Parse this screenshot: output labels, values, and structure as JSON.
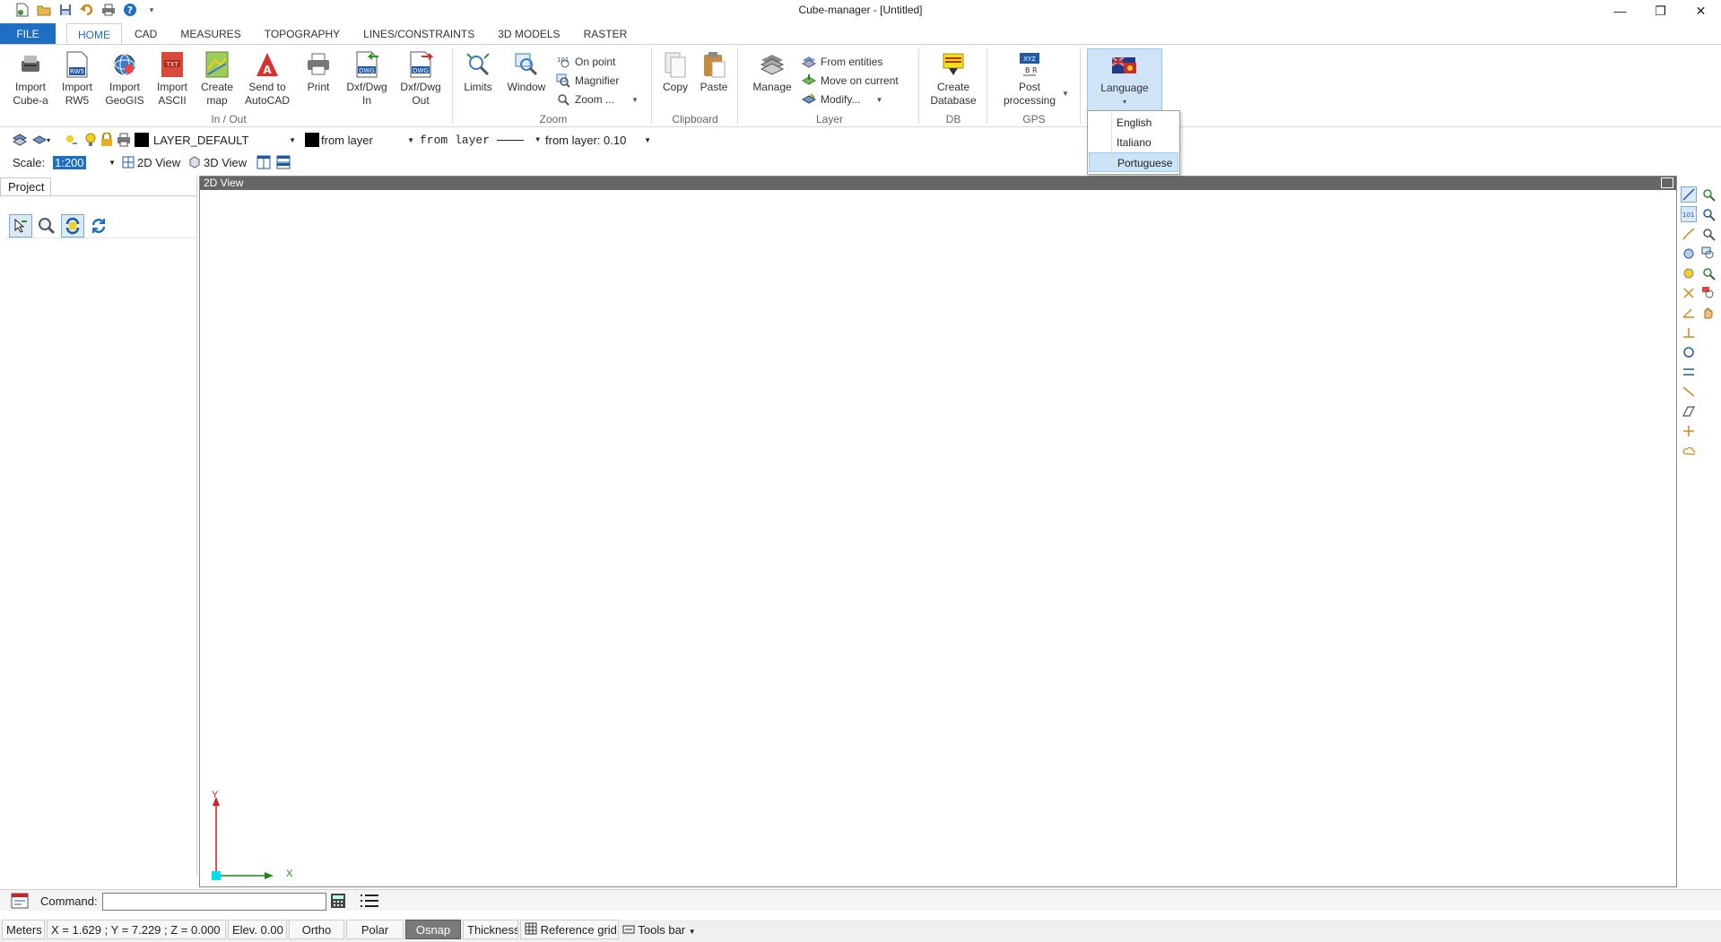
{
  "window": {
    "title": "Cube-manager - [Untitled]",
    "controls": [
      "—",
      "❐",
      "✕"
    ]
  },
  "tabs": [
    {
      "label": "FILE"
    },
    {
      "label": "HOME"
    },
    {
      "label": "CAD"
    },
    {
      "label": "MEASURES"
    },
    {
      "label": "TOPOGRAPHY"
    },
    {
      "label": "LINES/CONSTRAINTS"
    },
    {
      "label": "3D MODELS"
    },
    {
      "label": "RASTER"
    }
  ],
  "ribbon": {
    "inout": {
      "name": "In / Out",
      "buttons": [
        {
          "line1": "Import",
          "line2": "Cube-a"
        },
        {
          "line1": "Import",
          "line2": "RW5"
        },
        {
          "line1": "Import",
          "line2": "GeoGIS"
        },
        {
          "line1": "Import",
          "line2": "ASCII"
        },
        {
          "line1": "Create",
          "line2": "map"
        },
        {
          "line1": "Send to",
          "line2": "AutoCAD"
        },
        {
          "line1": "Print",
          "line2": ""
        },
        {
          "line1": "Dxf/Dwg",
          "line2": "In"
        },
        {
          "line1": "Dxf/Dwg",
          "line2": "Out"
        }
      ]
    },
    "zoom": {
      "name": "Zoom",
      "limits": "Limits",
      "window": "Window",
      "on_point": "On point",
      "magnifier": "Magnifier",
      "zoom_more": "Zoom ..."
    },
    "clipboard": {
      "name": "Clipboard",
      "copy": "Copy",
      "paste": "Paste"
    },
    "layer": {
      "name": "Layer",
      "manage": "Manage",
      "from_entities": "From entities",
      "move_on_current": "Move on current",
      "modify": "Modify..."
    },
    "db": {
      "name": "DB",
      "line1": "Create",
      "line2": "Database"
    },
    "gps": {
      "name": "GPS",
      "line1": "Post",
      "line2": "processing"
    },
    "language": {
      "label": "Language"
    }
  },
  "language_menu": {
    "items": [
      "English",
      "Italiano",
      "Portuguese"
    ],
    "selected": "Portuguese"
  },
  "layer_toolbar": {
    "layer_name": "LAYER_DEFAULT",
    "color": "from layer",
    "linetype": "from layer",
    "lineweight": "from layer: 0.10"
  },
  "scale_toolbar": {
    "scale_label": "Scale:",
    "scale_value": "1:200",
    "view2d": "2D View",
    "view3d": "3D View"
  },
  "project_panel": {
    "tab": "Project"
  },
  "view": {
    "title": "2D View",
    "axis_x": "X",
    "axis_y": "Y"
  },
  "command": {
    "label": "Command:",
    "value": ""
  },
  "status": {
    "units": "Meters",
    "coords": "X = 1.629 ; Y = 7.229 ; Z = 0.000",
    "elev": "Elev. 0.00",
    "ortho": "Ortho",
    "polar": "Polar",
    "osnap": "Osnap",
    "thickness": "Thickness",
    "ref_grid": "Reference grid",
    "tools_bar": "Tools bar"
  },
  "colors": {
    "accent": "#1e6fc4",
    "selected_bg": "#cce4f7",
    "language_btn": "#cfe4f7"
  }
}
